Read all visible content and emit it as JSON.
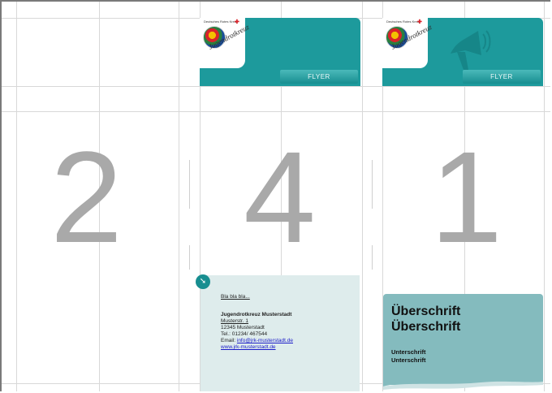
{
  "panels": [
    {
      "number": "2"
    },
    {
      "number": "4"
    },
    {
      "number": "1"
    }
  ],
  "header": {
    "brand_text": "Deutsches Rotes Kreuz",
    "logo_text": "Jugendrotkreuz",
    "flyer_label": "FLYER"
  },
  "contact": {
    "intro": "Bla bla bla...",
    "org": "Jugendrotkreuz Musterstadt",
    "street": "Musterstr. 1",
    "city": "12345 Musterstadt",
    "phone": "Tel.: 01234/ 467544",
    "email_label": "Email:",
    "email": "info@jrk-musterstadt.de",
    "web": "www.jrk-musterstadt.de"
  },
  "cover": {
    "heading_1": "Überschrift",
    "heading_2": "Überschrift",
    "sub_1": "Unterschrift",
    "sub_2": "Unterschrift"
  },
  "colors": {
    "teal": "#1d9a9c",
    "teal_light": "#84bbbe",
    "contact_bg": "#deecec",
    "page_number_gray": "#a9a9a9"
  }
}
